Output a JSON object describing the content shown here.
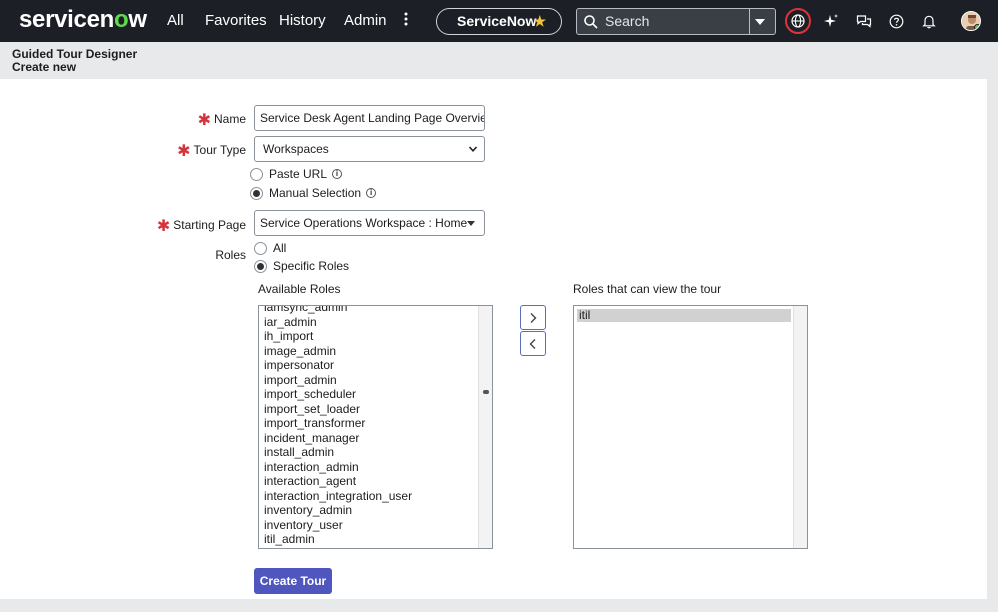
{
  "nav": {
    "logo_text_1": "servicen",
    "logo_text_2": "o",
    "logo_text_3": "w",
    "links": [
      "All",
      "Favorites",
      "History",
      "Admin"
    ],
    "instance_label": "ServiceNow",
    "search_placeholder": "Search",
    "icons": [
      "kebab-menu-icon",
      "star-icon",
      "search-icon",
      "chevron-down-icon",
      "globe-icon",
      "sparkle-icon",
      "chat-icon",
      "help-icon",
      "bell-icon",
      "avatar"
    ],
    "brand_color": "#1c2026",
    "accent_color": "#62d84e",
    "globe_ring_color": "#e0323c"
  },
  "header": {
    "title": "Guided Tour Designer",
    "subtitle": "Create new"
  },
  "form": {
    "name_label": "Name",
    "name_value": "Service Desk Agent Landing Page Overview",
    "tour_type_label": "Tour Type",
    "tour_type_value": "Workspaces",
    "paste_url_label": "Paste URL",
    "manual_selection_label": "Manual Selection",
    "starting_page_label": "Starting Page",
    "starting_page_value": "Service Operations Workspace : Home",
    "roles_label": "Roles",
    "roles_all_label": "All",
    "roles_specific_label": "Specific Roles",
    "available_roles_label": "Available Roles",
    "selected_roles_label": "Roles that can view the tour",
    "available_roles": [
      "iamsync_admin",
      "iar_admin",
      "ih_import",
      "image_admin",
      "impersonator",
      "import_admin",
      "import_scheduler",
      "import_set_loader",
      "import_transformer",
      "incident_manager",
      "install_admin",
      "interaction_admin",
      "interaction_agent",
      "interaction_integration_user",
      "inventory_admin",
      "inventory_user",
      "itil_admin"
    ],
    "selected_roles": [
      "itil"
    ],
    "create_button_label": "Create Tour",
    "primary_button_color": "#4f56bd",
    "required_color": "#d4343c"
  }
}
